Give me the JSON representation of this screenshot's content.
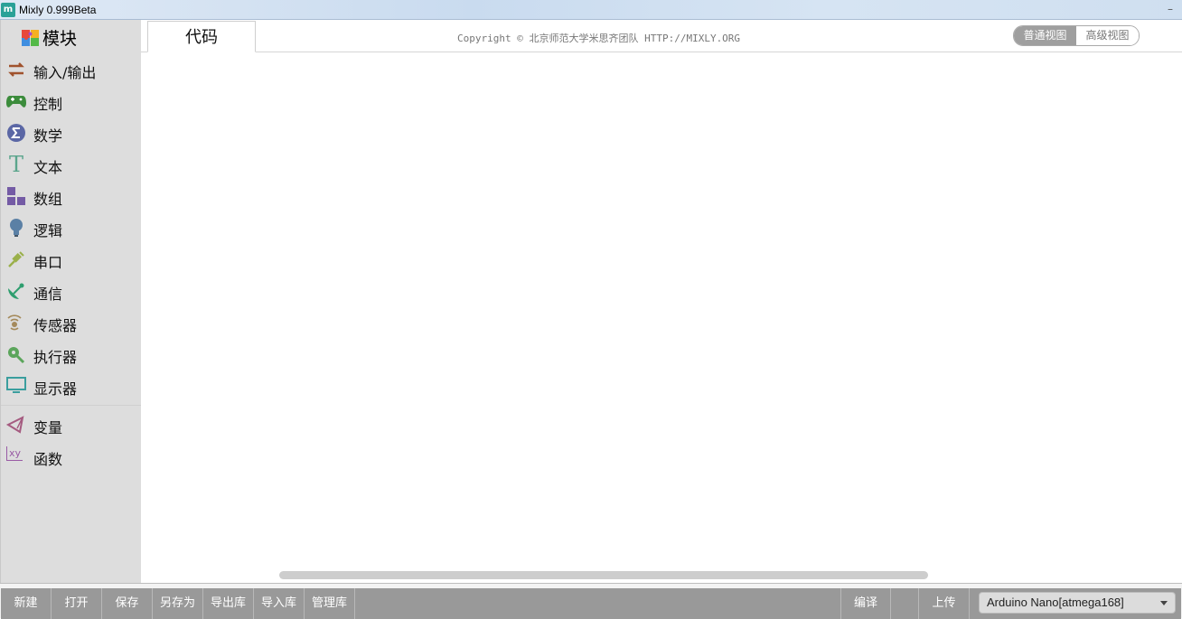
{
  "window": {
    "title": "Mixly 0.999Beta",
    "icon": "mixly-app-icon"
  },
  "sidebar": {
    "header": "模块",
    "categories": [
      {
        "label": "输入/输出",
        "icon": "io-arrows-icon",
        "color": "#a0522d"
      },
      {
        "label": "控制",
        "icon": "gamepad-icon",
        "color": "#3c8c3c"
      },
      {
        "label": "数学",
        "icon": "sigma-icon",
        "color": "#5b67a5"
      },
      {
        "label": "文本",
        "icon": "text-t-icon",
        "color": "#5ba58c"
      },
      {
        "label": "数组",
        "icon": "array-blocks-icon",
        "color": "#745ba5"
      },
      {
        "label": "逻辑",
        "icon": "lightbulb-icon",
        "color": "#5b80a5"
      },
      {
        "label": "串口",
        "icon": "usb-plug-icon",
        "color": "#9ab04a"
      },
      {
        "label": "通信",
        "icon": "satellite-icon",
        "color": "#2f9e6f"
      },
      {
        "label": "传感器",
        "icon": "sensor-waves-icon",
        "color": "#a58a5b"
      },
      {
        "label": "执行器",
        "icon": "actuator-icon",
        "color": "#5ba55b"
      },
      {
        "label": "显示器",
        "icon": "monitor-icon",
        "color": "#3a9e9e"
      },
      {
        "label": "变量",
        "icon": "variable-icon",
        "color": "#a55b80"
      },
      {
        "label": "函数",
        "icon": "function-xy-icon",
        "color": "#995ba5"
      }
    ]
  },
  "tabs": {
    "code": "代码"
  },
  "header": {
    "copyright": "Copyright © 北京师范大学米思齐团队 HTTP://MIXLY.ORG"
  },
  "view_toggle": {
    "normal": "普通视图",
    "advanced": "高级视图",
    "active": "normal"
  },
  "footer": {
    "buttons": [
      "新建",
      "打开",
      "保存",
      "另存为",
      "导出库",
      "导入库",
      "管理库"
    ],
    "compile": "编译",
    "upload": "上传",
    "board": "Arduino Nano[atmega168]"
  }
}
